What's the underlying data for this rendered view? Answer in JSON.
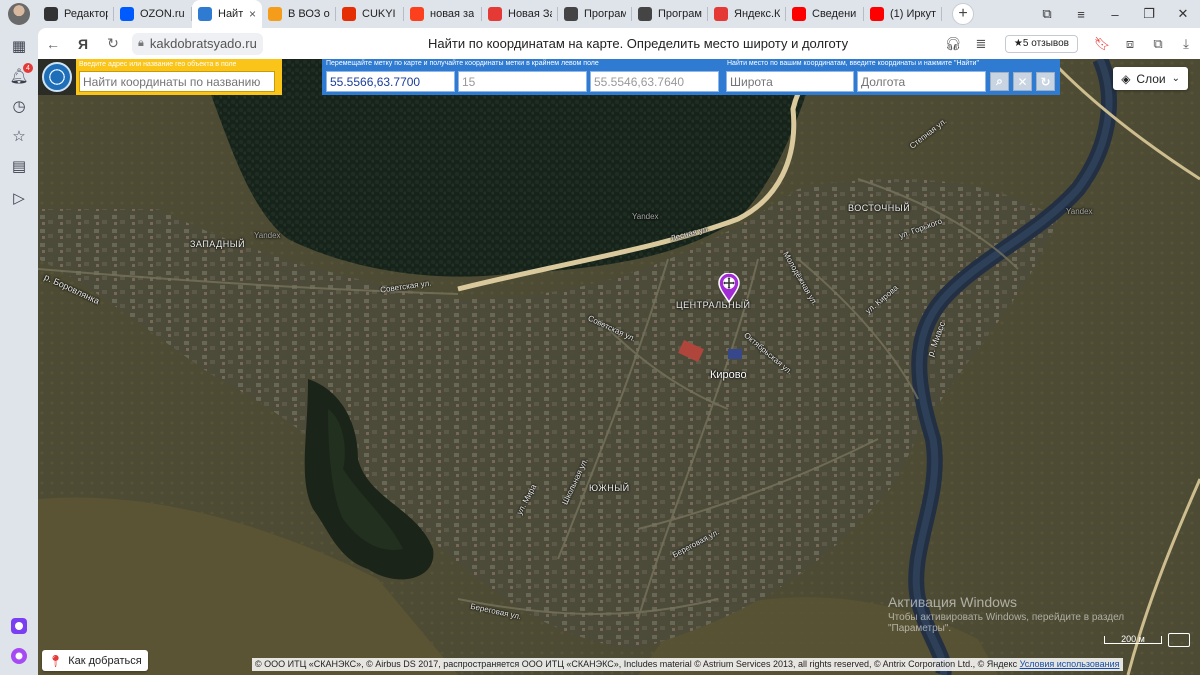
{
  "browser": {
    "tabs": [
      {
        "label": "Редактор",
        "icon": "plus-square-icon",
        "color": "#333333"
      },
      {
        "label": "OZON.ru",
        "icon": "ozon-icon",
        "color": "#005bff"
      },
      {
        "label": "Найти",
        "icon": "site-globe-icon",
        "color": "#2f7bd1",
        "active": true
      },
      {
        "label": "В ВОЗ об",
        "icon": "ribbon-icon",
        "color": "#f59c1a"
      },
      {
        "label": "CUKYI су",
        "icon": "aliexpress-icon",
        "color": "#e62e04"
      },
      {
        "label": "новая за",
        "icon": "yandex-icon",
        "color": "#fc3f1d"
      },
      {
        "label": "Новая За",
        "icon": "red-circle-icon",
        "color": "#e53935"
      },
      {
        "label": "Програм",
        "icon": "monitor-icon",
        "color": "#444444"
      },
      {
        "label": "Програм",
        "icon": "monitor-icon",
        "color": "#444444"
      },
      {
        "label": "Яндекс.К",
        "icon": "yandex-market-icon",
        "color": "#e53935"
      },
      {
        "label": "Сведени",
        "icon": "youtube-icon",
        "color": "#ff0000"
      },
      {
        "label": "(1) Иркут",
        "icon": "youtube-icon",
        "color": "#ff0000"
      }
    ],
    "close_glyph": "×",
    "new_tab_glyph": "+",
    "url": "kakdobratsyado.ru",
    "page_title": "Найти по координатам на карте. Определить место широту и долготу",
    "reviews_label": "★5 отзывов",
    "sidebar_badge": "4"
  },
  "search_panel": {
    "hint": "Введите адрес или название гео объекта в поле",
    "placeholder": "Найти координаты по названию"
  },
  "coord_panel": {
    "hint_move": "Перемещайте метку по карте и получайте координаты метки в крайнем левом поле",
    "hint_find": "Найти место по вашим координатам, введите координаты и нажмите \"Найти\"",
    "marker_coords": "55.5566,63.7700",
    "zoom": "15",
    "center_coords": "55.5546,63.7640",
    "lat_placeholder": "Широта",
    "lon_placeholder": "Долгота"
  },
  "map": {
    "layers_label": "Слои",
    "labels": {
      "town": "Кирово",
      "west": "ЗАПАДНЫЙ",
      "east": "ВОСТОЧНЫЙ",
      "central": "ЦЕНТРАЛЬНЫЙ",
      "south": "ЮЖНЫЙ",
      "river_borovlyanka": "р. Боровлянка",
      "river_miass": "р. Миасс",
      "st_sovetskaya1": "Советская ул.",
      "st_sovetskaya2": "Советская ул.",
      "st_lesnaya": "Лесная ул.",
      "st_beregovaya1": "Береговая ул.",
      "st_beregovaya2": "Береговая ул.",
      "st_stepnaya": "Степная ул.",
      "st_gorkogo": "ул. Горького",
      "st_shkolnaya": "Школьная ул.",
      "st_mira": "ул. Мира",
      "st_kirova": "ул. Кирова",
      "st_oktyabrskaya": "Октябрьская ул.",
      "st_molodezhnaya": "Молодёжная ул.",
      "yandex1": "Yandex",
      "yandex2": "Yandex",
      "yandex3": "Yandex"
    },
    "scale_label": "200 м",
    "route_button": "Как добраться",
    "copyright": "© ООО ИТЦ «СКАНЭКС», © Airbus DS 2017, распространяется ООО ИТЦ «СКАНЭКС», Includes material © Astrium Services 2013, all rights reserved, © Antrix Corporation Ltd., © Яндекс",
    "terms_link": "Условия использования",
    "watermark_title": "Активация Windows",
    "watermark_text": "Чтобы активировать Windows, перейдите в раздел \"Параметры\"."
  }
}
